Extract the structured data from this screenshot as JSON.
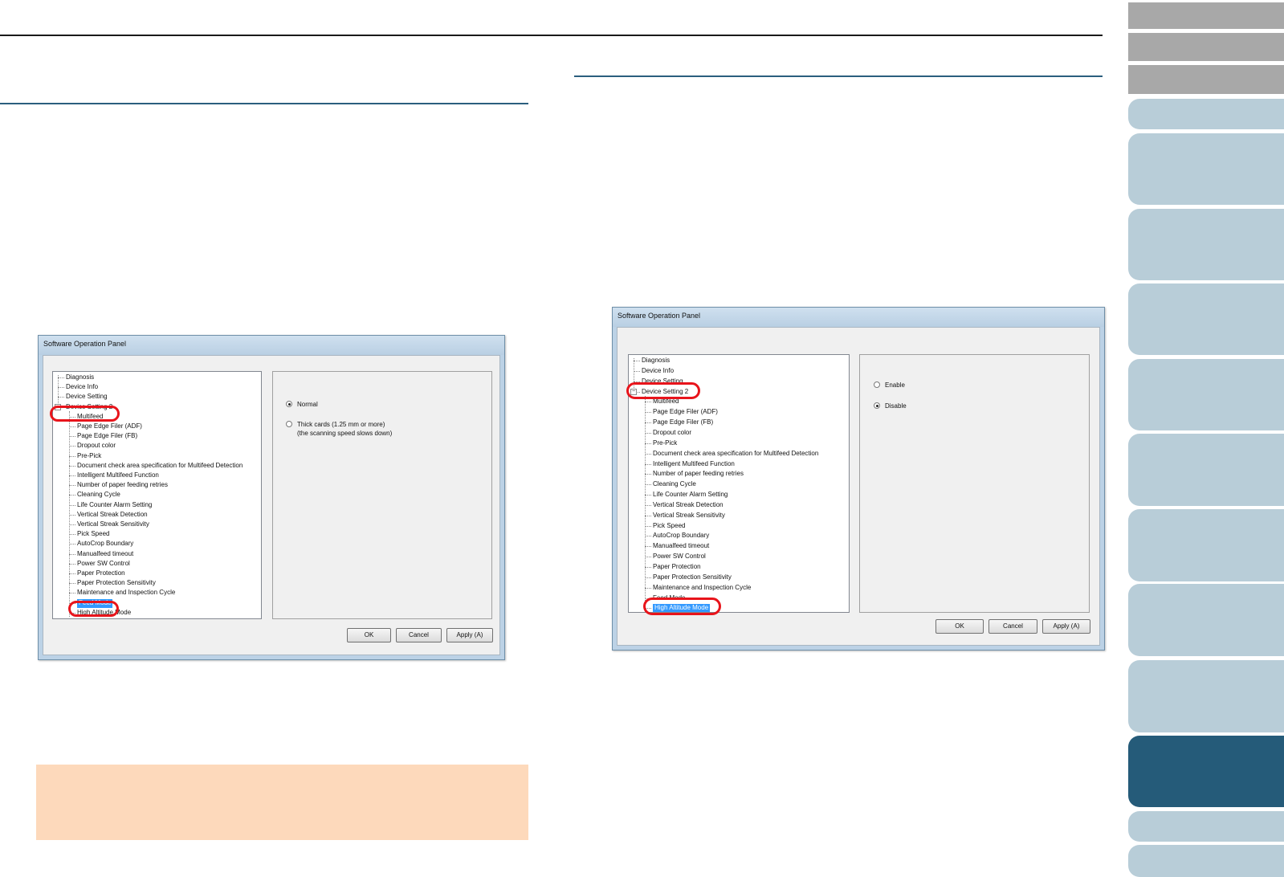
{
  "nav": {
    "tabs": [
      {
        "name": "tab-1",
        "style": "gray"
      },
      {
        "name": "tab-2",
        "style": "gray"
      },
      {
        "name": "tab-3",
        "style": "gray"
      },
      {
        "name": "tab-4",
        "style": "blue"
      },
      {
        "name": "tab-5",
        "style": "blue"
      },
      {
        "name": "tab-6",
        "style": "blue"
      },
      {
        "name": "tab-7",
        "style": "blue"
      },
      {
        "name": "tab-8",
        "style": "blue"
      },
      {
        "name": "tab-9",
        "style": "blue"
      },
      {
        "name": "tab-10",
        "style": "blue"
      },
      {
        "name": "tab-11",
        "style": "blue"
      },
      {
        "name": "tab-12",
        "style": "blue"
      },
      {
        "name": "tab-13",
        "style": "active"
      },
      {
        "name": "tab-14",
        "style": "blue"
      },
      {
        "name": "tab-15",
        "style": "blue"
      }
    ]
  },
  "colors": {
    "accent_rule": "#2b5e7e",
    "nav_active": "#255b79",
    "nav_inactive": "#b8cdd8",
    "nav_gray": "#a8a8a8",
    "highlight_ring": "#e8141b",
    "note_box": "#fdd9bb",
    "tree_selection": "#3399ff"
  },
  "dialog_left": {
    "title": "Software Operation Panel",
    "tree_top": [
      "Diagnosis",
      "Device Info",
      "Device Setting",
      "Device Setting 2"
    ],
    "tree_children": [
      "Multifeed",
      "Page Edge Filer (ADF)",
      "Page Edge Filer (FB)",
      "Dropout color",
      "Pre-Pick",
      "Document check area specification for Multifeed Detection",
      "Intelligent Multifeed Function",
      "Number of paper feeding retries",
      "Cleaning Cycle",
      "Life Counter Alarm Setting",
      "Vertical Streak Detection",
      "Vertical Streak Sensitivity",
      "Pick Speed",
      "AutoCrop Boundary",
      "Manualfeed timeout",
      "Power SW Control",
      "Paper Protection",
      "Paper Protection Sensitivity",
      "Maintenance and Inspection Cycle",
      "Feed Mode",
      "High Altitude Mode"
    ],
    "selected": "Feed Mode",
    "options": [
      {
        "label": "Normal",
        "checked": true
      },
      {
        "label": "Thick cards (1.25 mm or more)",
        "checked": false,
        "sub": "(the scanning speed slows down)"
      }
    ],
    "buttons": {
      "ok": "OK",
      "cancel": "Cancel",
      "apply": "Apply (A)"
    }
  },
  "dialog_right": {
    "title": "Software Operation Panel",
    "tree_top": [
      "Diagnosis",
      "Device Info",
      "Device Setting",
      "Device Setting 2"
    ],
    "tree_children": [
      "Multifeed",
      "Page Edge Filer (ADF)",
      "Page Edge Filer (FB)",
      "Dropout color",
      "Pre-Pick",
      "Document check area specification for Multifeed Detection",
      "Intelligent Multifeed Function",
      "Number of paper feeding retries",
      "Cleaning Cycle",
      "Life Counter Alarm Setting",
      "Vertical Streak Detection",
      "Vertical Streak Sensitivity",
      "Pick Speed",
      "AutoCrop Boundary",
      "Manualfeed timeout",
      "Power SW Control",
      "Paper Protection",
      "Paper Protection Sensitivity",
      "Maintenance and Inspection Cycle",
      "Feed Mode",
      "High Altitude Mode"
    ],
    "selected": "High Altitude Mode",
    "options": [
      {
        "label": "Enable",
        "checked": false
      },
      {
        "label": "Disable",
        "checked": true
      }
    ],
    "buttons": {
      "ok": "OK",
      "cancel": "Cancel",
      "apply": "Apply (A)"
    }
  }
}
